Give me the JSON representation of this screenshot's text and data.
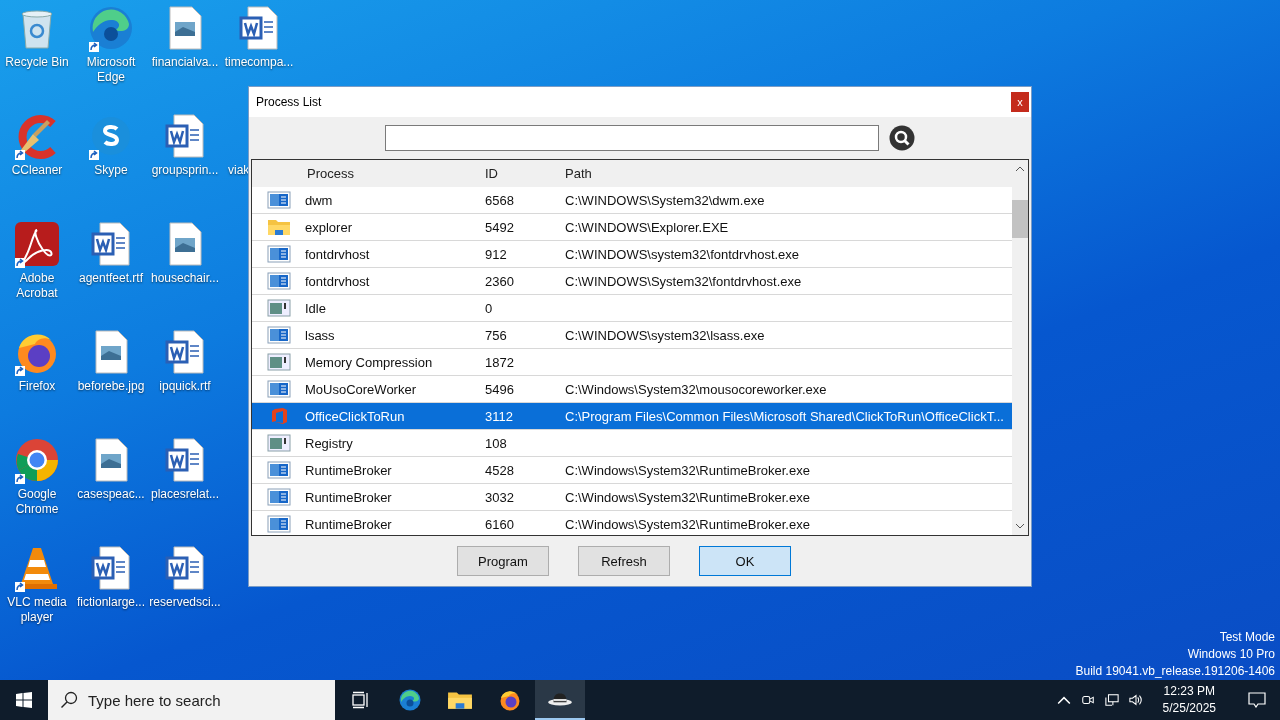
{
  "desktop": {
    "icons": [
      {
        "label": "Recycle Bin",
        "kind": "recycle",
        "shortcut": false
      },
      {
        "label": "CCleaner",
        "kind": "ccleaner",
        "shortcut": true
      },
      {
        "label": "Adobe Acrobat",
        "kind": "acrobat",
        "shortcut": true
      },
      {
        "label": "Firefox",
        "kind": "firefox",
        "shortcut": true
      },
      {
        "label": "Google Chrome",
        "kind": "chrome",
        "shortcut": true
      },
      {
        "label": "VLC media player",
        "kind": "vlc",
        "shortcut": true
      },
      {
        "label": "Microsoft Edge",
        "kind": "edge",
        "shortcut": true
      },
      {
        "label": "Skype",
        "kind": "skype",
        "shortcut": true
      },
      {
        "label": "agentfeet.rtf",
        "kind": "word",
        "shortcut": false
      },
      {
        "label": "beforebe.jpg",
        "kind": "image",
        "shortcut": false
      },
      {
        "label": "casespeac...",
        "kind": "image",
        "shortcut": false
      },
      {
        "label": "fictionlarge...",
        "kind": "word",
        "shortcut": false
      },
      {
        "label": "financialva...",
        "kind": "image",
        "shortcut": false
      },
      {
        "label": "groupsprin...",
        "kind": "word",
        "shortcut": false
      },
      {
        "label": "housechair...",
        "kind": "image",
        "shortcut": false
      },
      {
        "label": "ipquick.rtf",
        "kind": "word",
        "shortcut": false
      },
      {
        "label": "placesrelat...",
        "kind": "word",
        "shortcut": false
      },
      {
        "label": "reservedsci...",
        "kind": "word",
        "shortcut": false
      },
      {
        "label": "timecompa...",
        "kind": "word",
        "shortcut": false
      },
      {
        "label": "viak",
        "kind": "hidden",
        "shortcut": false
      }
    ]
  },
  "window": {
    "title": "Process List",
    "close": "x"
  },
  "table": {
    "columns": [
      "Process",
      "ID",
      "Path"
    ],
    "rows": [
      {
        "kind": "app",
        "process": "dwm",
        "id": "6568",
        "path": "C:\\WINDOWS\\System32\\dwm.exe",
        "selected": false
      },
      {
        "kind": "folder",
        "process": "explorer",
        "id": "5492",
        "path": "C:\\WINDOWS\\Explorer.EXE",
        "selected": false
      },
      {
        "kind": "app",
        "process": "fontdrvhost",
        "id": "912",
        "path": "C:\\WINDOWS\\system32\\fontdrvhost.exe",
        "selected": false
      },
      {
        "kind": "app",
        "process": "fontdrvhost",
        "id": "2360",
        "path": "C:\\WINDOWS\\System32\\fontdrvhost.exe",
        "selected": false
      },
      {
        "kind": "system",
        "process": "Idle",
        "id": "0",
        "selected": false
      },
      {
        "kind": "app",
        "process": "lsass",
        "id": "756",
        "path": "C:\\WINDOWS\\system32\\lsass.exe",
        "selected": false
      },
      {
        "kind": "system",
        "process": "Memory Compression",
        "id": "1872",
        "selected": false
      },
      {
        "kind": "app",
        "process": "MoUsoCoreWorker",
        "id": "5496",
        "path": "C:\\Windows\\System32\\mousocoreworker.exe",
        "selected": false
      },
      {
        "kind": "office",
        "process": "OfficeClickToRun",
        "id": "3112",
        "path": "C:\\Program Files\\Common Files\\Microsoft Shared\\ClickToRun\\OfficeClickT...",
        "selected": true
      },
      {
        "kind": "system",
        "process": "Registry",
        "id": "108",
        "selected": false
      },
      {
        "kind": "app",
        "process": "RuntimeBroker",
        "id": "4528",
        "path": "C:\\Windows\\System32\\RuntimeBroker.exe",
        "selected": false
      },
      {
        "kind": "app",
        "process": "RuntimeBroker",
        "id": "3032",
        "path": "C:\\Windows\\System32\\RuntimeBroker.exe",
        "selected": false
      },
      {
        "kind": "app",
        "process": "RuntimeBroker",
        "id": "6160",
        "path": "C:\\Windows\\System32\\RuntimeBroker.exe",
        "selected": false
      }
    ]
  },
  "buttons": [
    {
      "label": "Program",
      "default": false
    },
    {
      "label": "Refresh",
      "default": false
    },
    {
      "label": "OK",
      "default": true
    }
  ],
  "watermark_lines": [
    "Test Mode",
    "Windows 10 Pro",
    "Build 19041.vb_release.191206-1406"
  ],
  "taskbar": {
    "search_placeholder": "Type here to search",
    "apps": [
      {
        "kind": "edge",
        "selected": false
      },
      {
        "kind": "folder",
        "selected": false
      },
      {
        "kind": "firefox",
        "selected": false
      },
      {
        "kind": "hat",
        "selected": true
      }
    ],
    "time": "12:23 PM",
    "date": "5/25/2025"
  }
}
